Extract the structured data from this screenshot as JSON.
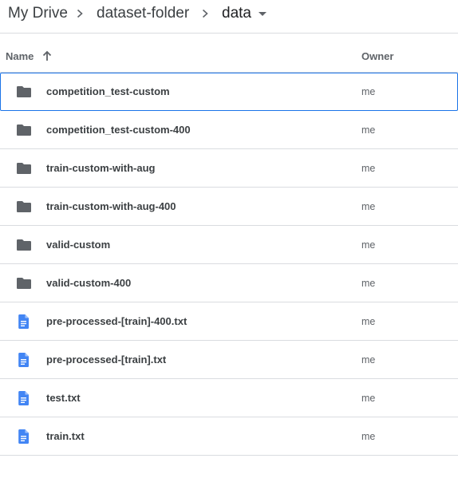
{
  "breadcrumb": {
    "items": [
      "My Drive",
      "dataset-folder",
      "data"
    ]
  },
  "columns": {
    "name": "Name",
    "owner": "Owner"
  },
  "files": [
    {
      "name": "competition_test-custom",
      "type": "folder",
      "owner": "me",
      "selected": true
    },
    {
      "name": "competition_test-custom-400",
      "type": "folder",
      "owner": "me"
    },
    {
      "name": "train-custom-with-aug",
      "type": "folder",
      "owner": "me"
    },
    {
      "name": "train-custom-with-aug-400",
      "type": "folder",
      "owner": "me"
    },
    {
      "name": "valid-custom",
      "type": "folder",
      "owner": "me"
    },
    {
      "name": "valid-custom-400",
      "type": "folder",
      "owner": "me"
    },
    {
      "name": "pre-processed-[train]-400.txt",
      "type": "document",
      "owner": "me"
    },
    {
      "name": "pre-processed-[train].txt",
      "type": "document",
      "owner": "me"
    },
    {
      "name": "test.txt",
      "type": "document",
      "owner": "me"
    },
    {
      "name": "train.txt",
      "type": "document",
      "owner": "me"
    }
  ],
  "colors": {
    "folder_icon": "#5f6368",
    "document_icon": "#4285f4",
    "selection_border": "#1a73e8",
    "divider": "#dadce0"
  }
}
